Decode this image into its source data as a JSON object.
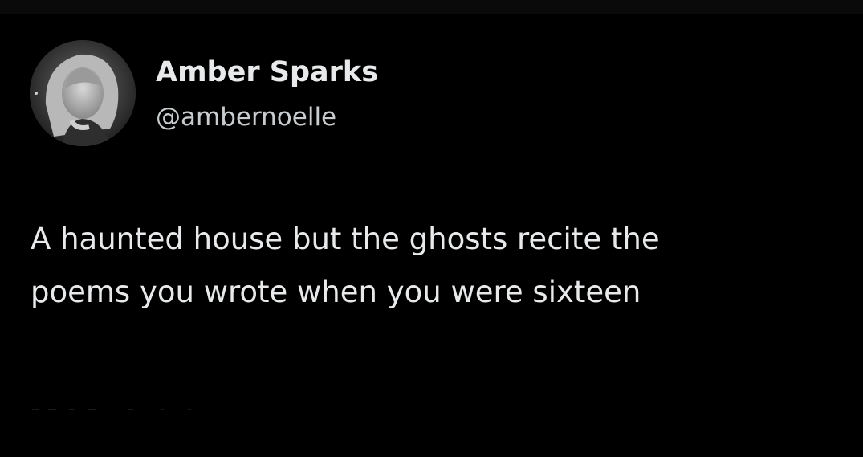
{
  "tweet": {
    "author": {
      "display_name": "Amber Sparks",
      "handle": "@ambernoelle",
      "avatar": "profile-photo"
    },
    "text_lines": [
      "A haunted house but the ghosts recite the",
      "poems you wrote when you were sixteen"
    ]
  },
  "colors": {
    "background": "#000000",
    "text": "#e7e9ea",
    "handle": "#c9ccce"
  }
}
